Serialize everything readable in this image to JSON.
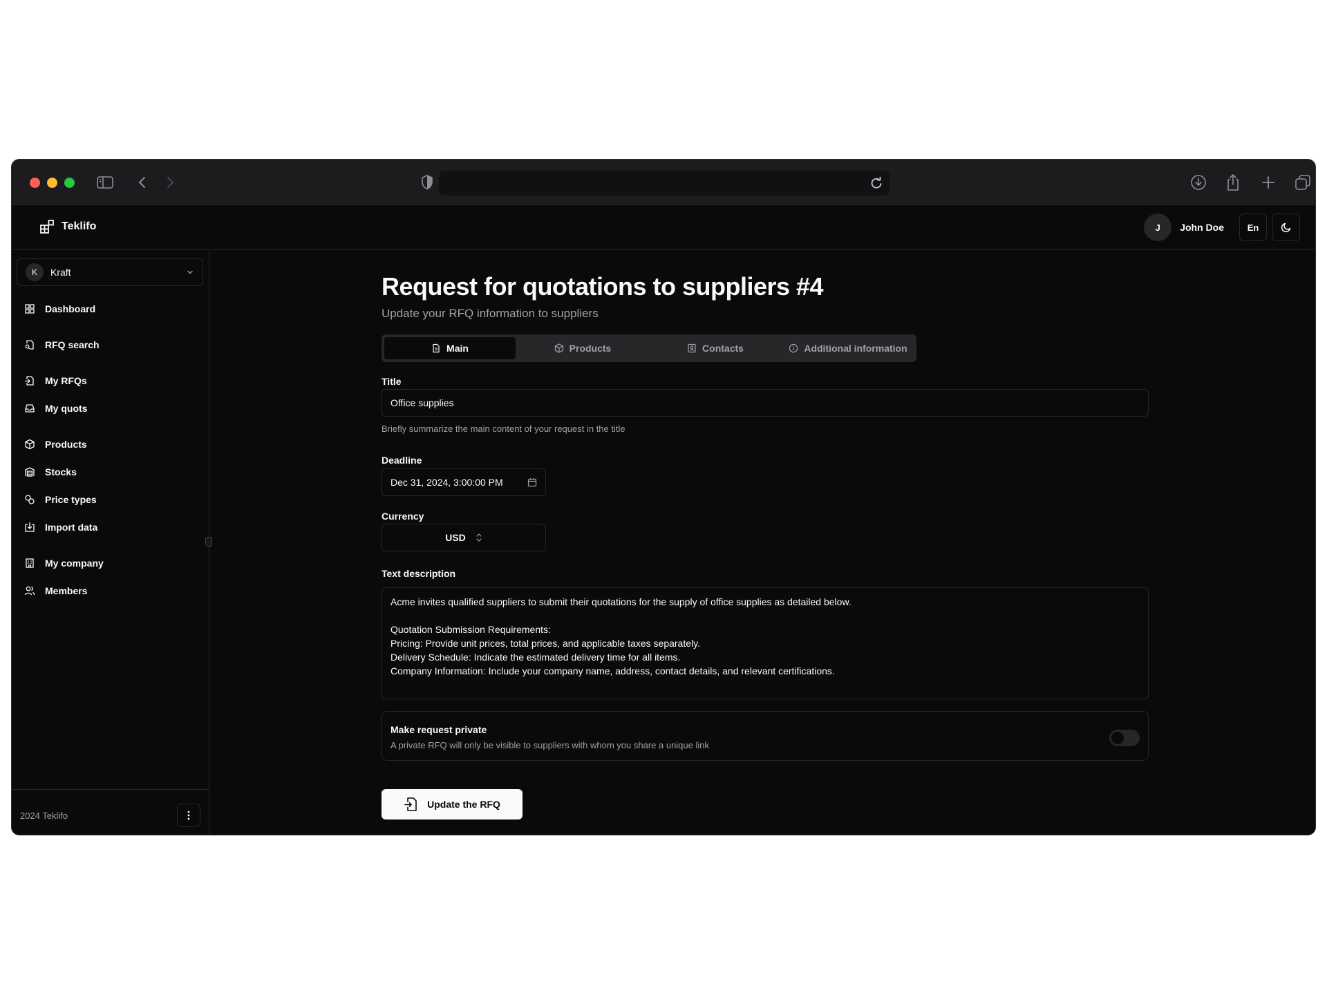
{
  "brand": {
    "name": "Teklifo"
  },
  "header": {
    "user_initial": "J",
    "user_name": "John Doe",
    "language": "En"
  },
  "sidebar": {
    "org": {
      "initial": "K",
      "name": "Kraft"
    },
    "items": [
      {
        "label": "Dashboard",
        "icon": "grid-icon"
      },
      {
        "label": "RFQ search",
        "icon": "file-search-icon"
      },
      {
        "label": "My RFQs",
        "icon": "file-out-icon"
      },
      {
        "label": "My quots",
        "icon": "inbox-icon"
      },
      {
        "label": "Products",
        "icon": "box-icon"
      },
      {
        "label": "Stocks",
        "icon": "warehouse-icon"
      },
      {
        "label": "Price types",
        "icon": "price-tag-icon"
      },
      {
        "label": "Import data",
        "icon": "import-icon"
      },
      {
        "label": "My company",
        "icon": "building-icon"
      },
      {
        "label": "Members",
        "icon": "users-icon"
      }
    ],
    "footer": "2024 Teklifo"
  },
  "page": {
    "title": "Request for quotations to suppliers #4",
    "subtitle": "Update your RFQ information to suppliers"
  },
  "tabs": [
    {
      "label": "Main",
      "active": true
    },
    {
      "label": "Products",
      "active": false
    },
    {
      "label": "Contacts",
      "active": false
    },
    {
      "label": "Additional information",
      "active": false
    }
  ],
  "form": {
    "title_label": "Title",
    "title_value": "Office supplies",
    "title_hint": "Briefly summarize the main content of your request in the title",
    "deadline_label": "Deadline",
    "deadline_value": "Dec 31, 2024, 3:00:00 PM",
    "currency_label": "Currency",
    "currency_value": "USD",
    "description_label": "Text description",
    "description_value": "Acme invites qualified suppliers to submit their quotations for the supply of office supplies as detailed below.\n\nQuotation Submission Requirements:\nPricing: Provide unit prices, total prices, and applicable taxes separately.\nDelivery Schedule: Indicate the estimated delivery time for all items.\nCompany Information: Include your company name, address, contact details, and relevant certifications.",
    "private_title": "Make request private",
    "private_desc": "A private RFQ will only be visible to suppliers with whom you share a unique link",
    "private_enabled": false,
    "submit_label": "Update the RFQ"
  },
  "colors": {
    "background": "#0a0a0b",
    "border": "#27272a",
    "muted_text": "#a1a1aa",
    "primary": "#fafafa"
  }
}
